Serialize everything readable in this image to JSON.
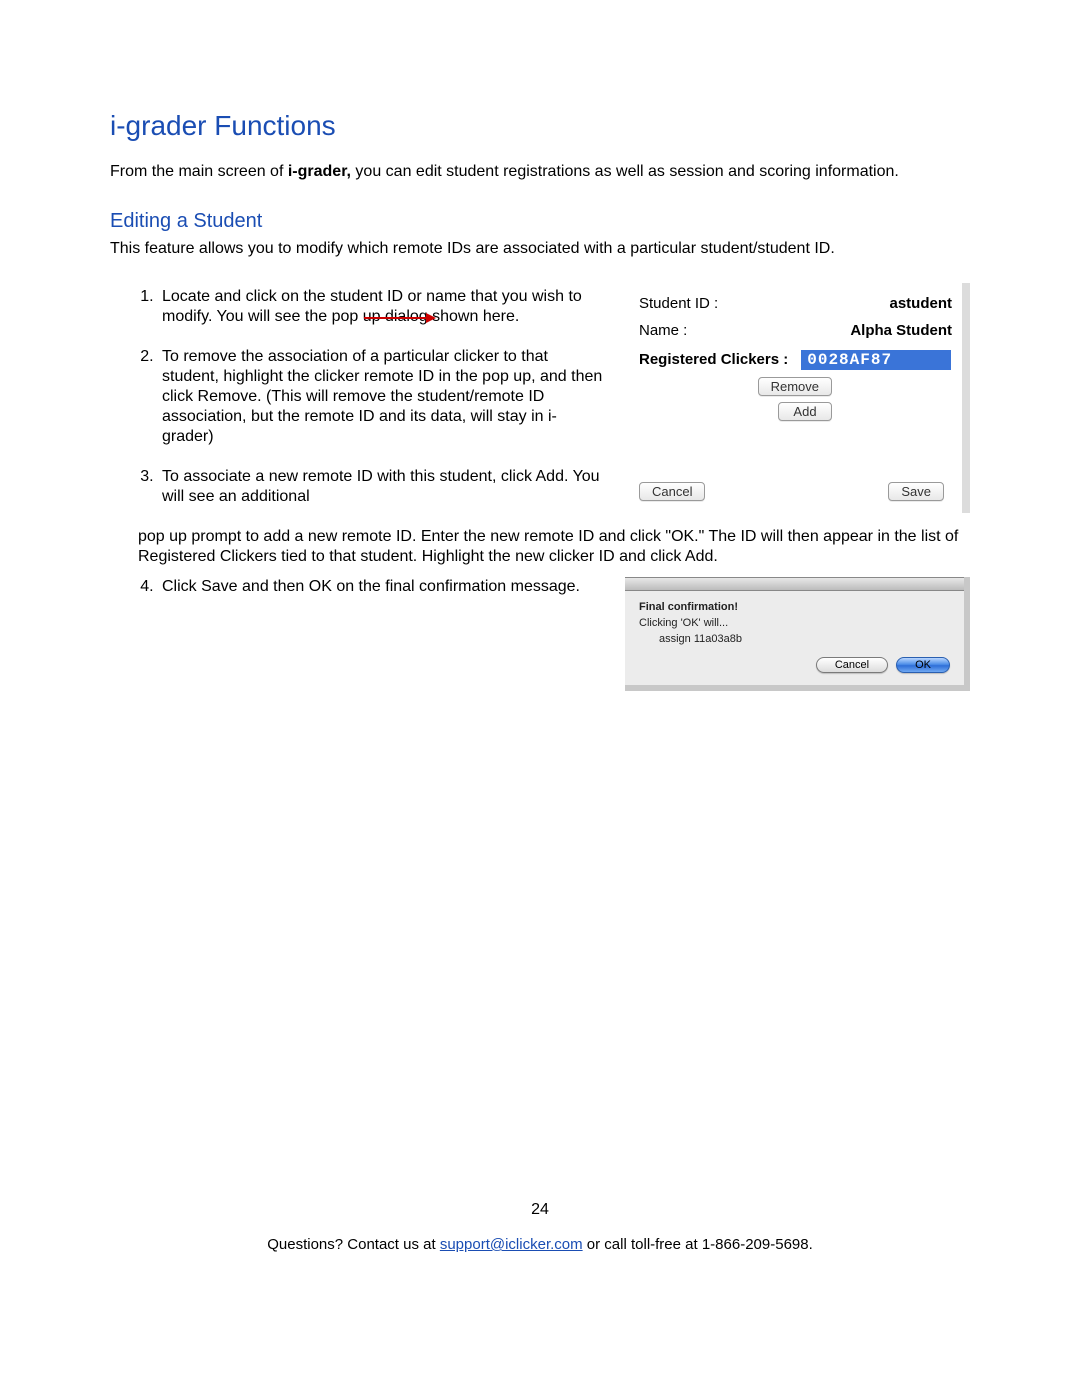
{
  "heading": "i-grader Functions",
  "intro_pre": "From the main screen of ",
  "intro_bold": "i-grader,",
  "intro_post": " you can edit student registrations as well as session and scoring information.",
  "subheading": "Editing a Student",
  "sub_intro": "This feature allows you to modify which remote IDs are associated with a particular student/student ID.",
  "steps": {
    "s1a": "Locate and click on the student ID or name that you wish to modify. You will ",
    "s1b": "see the pop",
    "s1c": " up dialog shown here.",
    "s2": "To remove the association of a particular clicker to that student, highlight the clicker remote ID in the pop up, and then click Remove. (This will remove the student/remote ID association, but the remote ID and its data, will stay in i-grader)",
    "s3a": "To associate a new remote ID with this student, click Add. You will see an additional",
    "s3b": "pop up prompt to add a new remote ID.  Enter the new remote ID and click \"OK.\"  The ID will then appear in the list of Registered Clickers tied to that student. Highlight the new clicker ID and click Add.",
    "s4": "Click Save and then OK on the final confirmation message."
  },
  "student_dialog": {
    "student_id_label": "Student ID :",
    "student_id_value": "astudent",
    "name_label": "Name :",
    "name_value": "Alpha Student",
    "registered_label": "Registered Clickers :",
    "clicker_id": "0028AF87",
    "remove_btn": "Remove",
    "add_btn": "Add",
    "cancel_btn": "Cancel",
    "save_btn": "Save"
  },
  "confirm_dialog": {
    "title": "Final confirmation!",
    "line": "Clicking 'OK' will...",
    "assign": "assign 11a03a8b",
    "cancel_btn": "Cancel",
    "ok_btn": "OK"
  },
  "page_number": "24",
  "footer": {
    "pre": "Questions? Contact us at ",
    "email": "support@iclicker.com",
    "mid": " or call toll-free at ",
    "phone": "1-866-209-5698."
  }
}
